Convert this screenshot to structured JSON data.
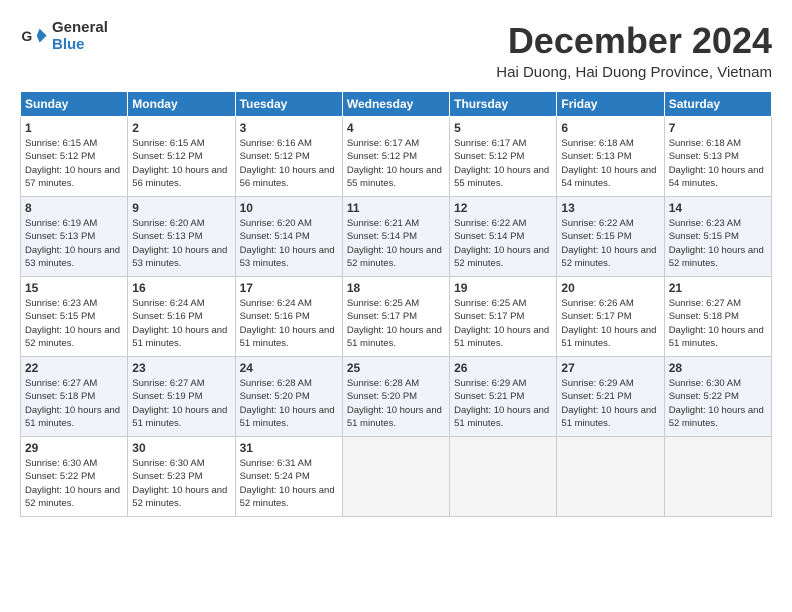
{
  "logo": {
    "general": "General",
    "blue": "Blue"
  },
  "title": "December 2024",
  "subtitle": "Hai Duong, Hai Duong Province, Vietnam",
  "days_of_week": [
    "Sunday",
    "Monday",
    "Tuesday",
    "Wednesday",
    "Thursday",
    "Friday",
    "Saturday"
  ],
  "weeks": [
    [
      {
        "day": "1",
        "sunrise": "6:15 AM",
        "sunset": "5:12 PM",
        "daylight": "10 hours and 57 minutes."
      },
      {
        "day": "2",
        "sunrise": "6:15 AM",
        "sunset": "5:12 PM",
        "daylight": "10 hours and 56 minutes."
      },
      {
        "day": "3",
        "sunrise": "6:16 AM",
        "sunset": "5:12 PM",
        "daylight": "10 hours and 56 minutes."
      },
      {
        "day": "4",
        "sunrise": "6:17 AM",
        "sunset": "5:12 PM",
        "daylight": "10 hours and 55 minutes."
      },
      {
        "day": "5",
        "sunrise": "6:17 AM",
        "sunset": "5:12 PM",
        "daylight": "10 hours and 55 minutes."
      },
      {
        "day": "6",
        "sunrise": "6:18 AM",
        "sunset": "5:13 PM",
        "daylight": "10 hours and 54 minutes."
      },
      {
        "day": "7",
        "sunrise": "6:18 AM",
        "sunset": "5:13 PM",
        "daylight": "10 hours and 54 minutes."
      }
    ],
    [
      {
        "day": "8",
        "sunrise": "6:19 AM",
        "sunset": "5:13 PM",
        "daylight": "10 hours and 53 minutes."
      },
      {
        "day": "9",
        "sunrise": "6:20 AM",
        "sunset": "5:13 PM",
        "daylight": "10 hours and 53 minutes."
      },
      {
        "day": "10",
        "sunrise": "6:20 AM",
        "sunset": "5:14 PM",
        "daylight": "10 hours and 53 minutes."
      },
      {
        "day": "11",
        "sunrise": "6:21 AM",
        "sunset": "5:14 PM",
        "daylight": "10 hours and 52 minutes."
      },
      {
        "day": "12",
        "sunrise": "6:22 AM",
        "sunset": "5:14 PM",
        "daylight": "10 hours and 52 minutes."
      },
      {
        "day": "13",
        "sunrise": "6:22 AM",
        "sunset": "5:15 PM",
        "daylight": "10 hours and 52 minutes."
      },
      {
        "day": "14",
        "sunrise": "6:23 AM",
        "sunset": "5:15 PM",
        "daylight": "10 hours and 52 minutes."
      }
    ],
    [
      {
        "day": "15",
        "sunrise": "6:23 AM",
        "sunset": "5:15 PM",
        "daylight": "10 hours and 52 minutes."
      },
      {
        "day": "16",
        "sunrise": "6:24 AM",
        "sunset": "5:16 PM",
        "daylight": "10 hours and 51 minutes."
      },
      {
        "day": "17",
        "sunrise": "6:24 AM",
        "sunset": "5:16 PM",
        "daylight": "10 hours and 51 minutes."
      },
      {
        "day": "18",
        "sunrise": "6:25 AM",
        "sunset": "5:17 PM",
        "daylight": "10 hours and 51 minutes."
      },
      {
        "day": "19",
        "sunrise": "6:25 AM",
        "sunset": "5:17 PM",
        "daylight": "10 hours and 51 minutes."
      },
      {
        "day": "20",
        "sunrise": "6:26 AM",
        "sunset": "5:17 PM",
        "daylight": "10 hours and 51 minutes."
      },
      {
        "day": "21",
        "sunrise": "6:27 AM",
        "sunset": "5:18 PM",
        "daylight": "10 hours and 51 minutes."
      }
    ],
    [
      {
        "day": "22",
        "sunrise": "6:27 AM",
        "sunset": "5:18 PM",
        "daylight": "10 hours and 51 minutes."
      },
      {
        "day": "23",
        "sunrise": "6:27 AM",
        "sunset": "5:19 PM",
        "daylight": "10 hours and 51 minutes."
      },
      {
        "day": "24",
        "sunrise": "6:28 AM",
        "sunset": "5:20 PM",
        "daylight": "10 hours and 51 minutes."
      },
      {
        "day": "25",
        "sunrise": "6:28 AM",
        "sunset": "5:20 PM",
        "daylight": "10 hours and 51 minutes."
      },
      {
        "day": "26",
        "sunrise": "6:29 AM",
        "sunset": "5:21 PM",
        "daylight": "10 hours and 51 minutes."
      },
      {
        "day": "27",
        "sunrise": "6:29 AM",
        "sunset": "5:21 PM",
        "daylight": "10 hours and 51 minutes."
      },
      {
        "day": "28",
        "sunrise": "6:30 AM",
        "sunset": "5:22 PM",
        "daylight": "10 hours and 52 minutes."
      }
    ],
    [
      {
        "day": "29",
        "sunrise": "6:30 AM",
        "sunset": "5:22 PM",
        "daylight": "10 hours and 52 minutes."
      },
      {
        "day": "30",
        "sunrise": "6:30 AM",
        "sunset": "5:23 PM",
        "daylight": "10 hours and 52 minutes."
      },
      {
        "day": "31",
        "sunrise": "6:31 AM",
        "sunset": "5:24 PM",
        "daylight": "10 hours and 52 minutes."
      },
      null,
      null,
      null,
      null
    ]
  ]
}
